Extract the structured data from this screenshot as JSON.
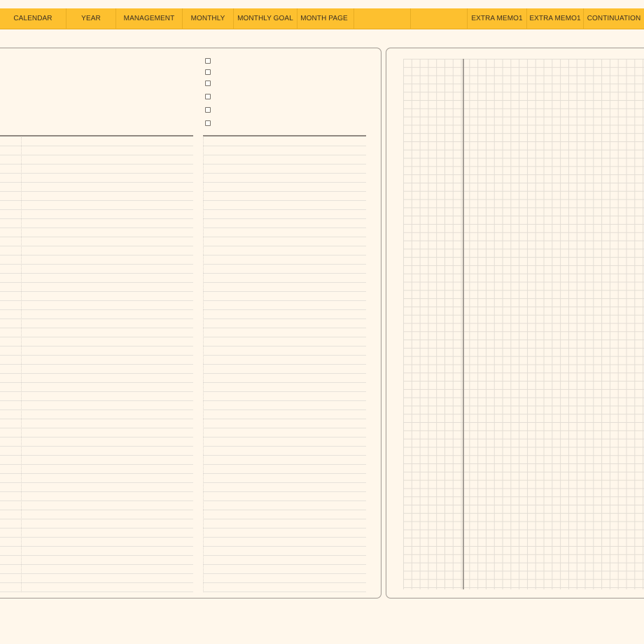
{
  "nav": {
    "tabs": [
      {
        "label": "CALENDAR"
      },
      {
        "label": "YEAR"
      },
      {
        "label": "MANAGEMENT"
      },
      {
        "label": "MONTHLY"
      },
      {
        "label": "MONTHLY GOAL"
      },
      {
        "label": "MONTH PAGE"
      },
      {
        "label": ""
      },
      {
        "label": ""
      },
      {
        "label": "EXTRA MEMO1"
      },
      {
        "label": "EXTRA MEMO1"
      },
      {
        "label": "CONTINUATION"
      }
    ]
  },
  "checklist": {
    "item_count_visible": 6
  },
  "colors": {
    "background": "#fff7eb",
    "nav_bar": "#fdc02f",
    "panel_border": "#a09a92",
    "rule_line": "#e7e2da",
    "grid_line": "#e3ddd4"
  }
}
